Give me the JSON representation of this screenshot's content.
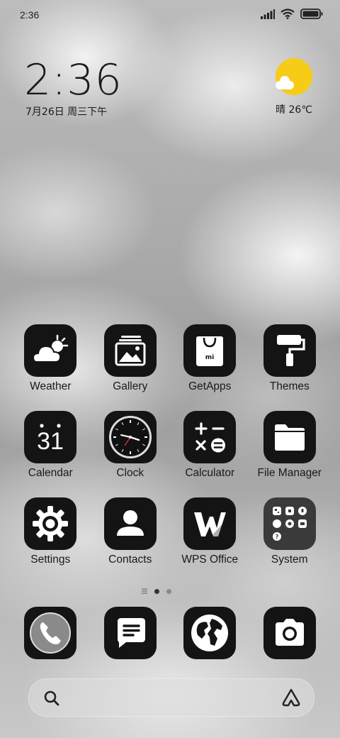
{
  "status_bar": {
    "time": "2:36"
  },
  "lockclock": {
    "time": "2:36",
    "date": "7月26日 周三下午"
  },
  "weather_widget": {
    "text": "晴 26℃",
    "sun_color": "#f6cc16"
  },
  "apps": [
    {
      "label": "Weather",
      "icon": "weather-icon"
    },
    {
      "label": "Gallery",
      "icon": "gallery-icon"
    },
    {
      "label": "GetApps",
      "icon": "getapps-icon"
    },
    {
      "label": "Themes",
      "icon": "themes-icon"
    },
    {
      "label": "Calendar",
      "icon": "calendar-icon",
      "day": "31"
    },
    {
      "label": "Clock",
      "icon": "clock-icon"
    },
    {
      "label": "Calculator",
      "icon": "calculator-icon"
    },
    {
      "label": "File Manager",
      "icon": "folder-icon"
    },
    {
      "label": "Settings",
      "icon": "gear-icon"
    },
    {
      "label": "Contacts",
      "icon": "contact-icon"
    },
    {
      "label": "WPS Office",
      "icon": "wps-icon"
    },
    {
      "label": "System",
      "icon": "system-folder-icon"
    }
  ],
  "getapps_logo": "mi",
  "page_indicator": {
    "pages": 2,
    "active": 0
  },
  "dock": [
    {
      "icon": "phone-icon"
    },
    {
      "icon": "messages-icon"
    },
    {
      "icon": "browser-icon"
    },
    {
      "icon": "camera-icon"
    }
  ],
  "search_bar": {
    "left_icon": "search-icon",
    "right_icon": "assistant-icon"
  },
  "colors": {
    "icon_bg": "#141414",
    "label": "#1a1a1a"
  }
}
